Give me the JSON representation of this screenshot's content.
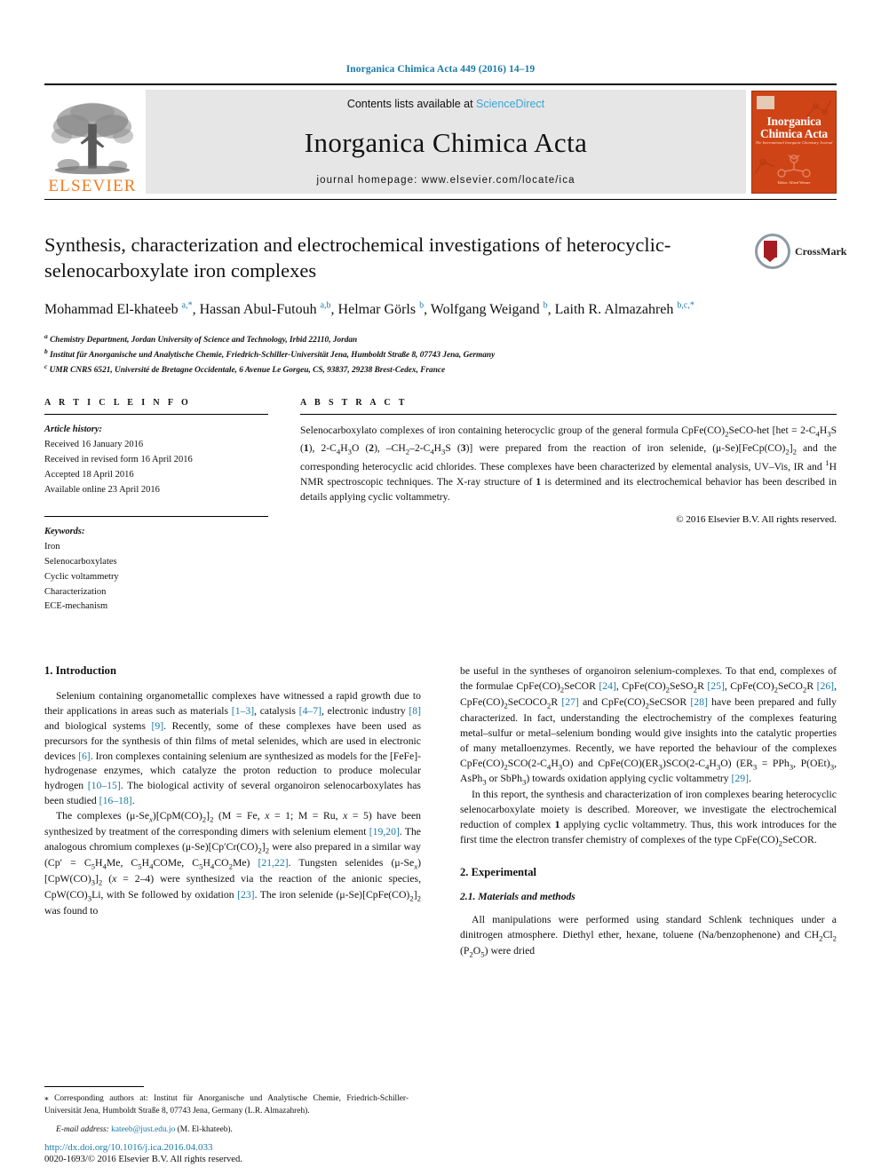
{
  "running_head": "Inorganica Chimica Acta 449 (2016) 14–19",
  "masthead": {
    "publisher_name": "ELSEVIER",
    "contents_prefix": "Contents lists available at ",
    "contents_link": "ScienceDirect",
    "journal_title": "Inorganica Chimica Acta",
    "homepage": "journal homepage: www.elsevier.com/locate/ica",
    "cover": {
      "line1": "Inorganica",
      "line2": "Chimica Acta",
      "subtitle": "The International Inorganic Chemistry Journal",
      "footer": "Editor: Alfred Werner"
    }
  },
  "article": {
    "title": "Synthesis, characterization and electrochemical investigations of heterocyclic-selenocarboxylate iron complexes",
    "crossmark_label": "CrossMark",
    "authors_html": "Mohammad El-khateeb <sup>a,*</sup>, Hassan Abul-Futouh <sup>a,b</sup>, Helmar Görls <sup>b</sup>, Wolfgang Weigand <sup>b</sup>, Laith R. Almazahreh <sup>b,c,*</sup>",
    "affiliations": [
      "<sup>a</sup> Chemistry Department, Jordan University of Science and Technology, Irbid 22110, Jordan",
      "<sup>b</sup> Institut für Anorganische und Analytische Chemie, Friedrich-Schiller-Universität Jena, Humboldt Straße 8, 07743 Jena, Germany",
      "<sup>c</sup> UMR CNRS 6521, Université de Bretagne Occidentale, 6 Avenue Le Gorgeu, CS, 93837, 29238 Brest-Cedex, France"
    ]
  },
  "article_info": {
    "heading": "A R T I C L E   I N F O",
    "history_label": "Article history:",
    "history": [
      "Received 16 January 2016",
      "Received in revised form 16 April 2016",
      "Accepted 18 April 2016",
      "Available online 23 April 2016"
    ],
    "keywords_label": "Keywords:",
    "keywords": [
      "Iron",
      "Selenocarboxylates",
      "Cyclic voltammetry",
      "Characterization",
      "ECE-mechanism"
    ]
  },
  "abstract": {
    "heading": "A B S T R A C T",
    "text_html": "Selenocarboxylato complexes of iron containing heterocyclic group of the general formula CpFe(CO)<sub>2</sub>SeCO-het [het = 2-C<sub>4</sub>H<sub>3</sub>S (<b>1</b>), 2-C<sub>4</sub>H<sub>3</sub>O (<b>2</b>), –CH<sub>2</sub>–2-C<sub>4</sub>H<sub>3</sub>S (<b>3</b>)] were prepared from the reaction of iron selenide, (μ-Se)[FeCp(CO)<sub>2</sub>]<sub>2</sub> and the corresponding heterocyclic acid chlorides. These complexes have been characterized by elemental analysis, UV–Vis, IR and <sup>1</sup>H NMR spectroscopic techniques. The X-ray structure of <b>1</b> is determined and its electrochemical behavior has been described in details applying cyclic voltammetry.",
    "copyright": "© 2016 Elsevier B.V. All rights reserved."
  },
  "body": {
    "introduction_heading": "1. Introduction",
    "intro_p1_html": "Selenium containing organometallic complexes have witnessed a rapid growth due to their applications in areas such as materials <span class=\"ref\">[1–3]</span>, catalysis <span class=\"ref\">[4–7]</span>, electronic industry <span class=\"ref\">[8]</span> and biological systems <span class=\"ref\">[9]</span>. Recently, some of these complexes have been used as precursors for the synthesis of thin films of metal selenides, which are used in electronic devices <span class=\"ref\">[6]</span>. Iron complexes containing selenium are synthesized as models for the [FeFe]-hydrogenase enzymes, which catalyze the proton reduction to produce molecular hydrogen <span class=\"ref\">[10–15]</span>. The biological activity of several organoiron selenocarboxylates has been studied <span class=\"ref\">[16–18]</span>.",
    "intro_p2_html": "The complexes (μ-Se<sub><i>x</i></sub>)[CpM(CO)<sub>2</sub>]<sub>2</sub> (M = Fe, <i>x</i> = 1; M = Ru, <i>x</i> = 5) have been synthesized by treatment of the corresponding dimers with selenium element <span class=\"ref\">[19,20]</span>. The analogous chromium complexes (μ-Se)[Cp′Cr(CO)<sub>2</sub>]<sub>2</sub> were also prepared in a similar way (Cp′ = C<sub>5</sub>H<sub>4</sub>Me, C<sub>5</sub>H<sub>4</sub>COMe, C<sub>5</sub>H<sub>4</sub>CO<sub>2</sub>Me) <span class=\"ref\">[21,22]</span>. Tungsten selenides (μ-Se<sub><i>x</i></sub>)[CpW(CO)<sub>3</sub>]<sub>2</sub> (<i>x</i> = 2–4) were synthesized via the reaction of the anionic species, CpW(CO)<sub>3</sub>Li, with Se followed by oxidation <span class=\"ref\">[23]</span>. The iron selenide (μ-Se)[CpFe(CO)<sub>2</sub>]<sub>2</sub> was found to",
    "right_p1_html": "be useful in the syntheses of organoiron selenium-complexes. To that end, complexes of the formulae CpFe(CO)<sub>2</sub>SeCOR <span class=\"ref\">[24]</span>, CpFe(CO)<sub>2</sub>SeSO<sub>2</sub>R <span class=\"ref\">[25]</span>, CpFe(CO)<sub>2</sub>SeCO<sub>2</sub>R <span class=\"ref\">[26]</span>, CpFe(CO)<sub>2</sub>SeCOCO<sub>2</sub>R <span class=\"ref\">[27]</span> and CpFe(CO)<sub>2</sub>SeCSOR <span class=\"ref\">[28]</span> have been prepared and fully characterized. In fact, understanding the electrochemistry of the complexes featuring metal–sulfur or metal–selenium bonding would give insights into the catalytic properties of many metalloenzymes. Recently, we have reported the behaviour of the complexes CpFe(CO)<sub>2</sub>SCO(2-C<sub>4</sub>H<sub>3</sub>O) and CpFe(CO)(ER<sub>3</sub>)SCO(2-C<sub>4</sub>H<sub>3</sub>O) (ER<sub>3</sub> = PPh<sub>3</sub>, P(OEt)<sub>3</sub>, AsPh<sub>3</sub> or SbPh<sub>3</sub>) towards oxidation applying cyclic voltammetry <span class=\"ref\">[29]</span>.",
    "right_p2_html": "In this report, the synthesis and characterization of iron complexes bearing heterocyclic selenocarboxylate moiety is described. Moreover, we investigate the electrochemical reduction of complex <b>1</b> applying cyclic voltammetry. Thus, this work introduces for the first time the electron transfer chemistry of complexes of the type CpFe(CO)<sub>2</sub>SeCOR.",
    "experimental_heading": "2. Experimental",
    "materials_heading": "2.1. Materials and methods",
    "materials_p1_html": "All manipulations were performed using standard Schlenk techniques under a dinitrogen atmosphere. Diethyl ether, hexane, toluene (Na/benzophenone) and CH<sub>2</sub>Cl<sub>2</sub> (P<sub>2</sub>O<sub>5</sub>) were dried"
  },
  "footer": {
    "corresponding_html": "⁎ Corresponding authors at: Institut für Anorganische und Analytische Chemie, Friedrich-Schiller-Universität Jena, Humboldt Straße 8, 07743 Jena, Germany (L.R. Almazahreh).",
    "email_label": "E-mail address:",
    "email": "kateeb@just.edu.jo",
    "email_owner": "(M. El-khateeb).",
    "doi": "http://dx.doi.org/10.1016/j.ica.2016.04.033",
    "issn_line": "0020-1693/© 2016 Elsevier B.V. All rights reserved."
  },
  "colors": {
    "link_blue": "#1a7aa8",
    "sciencedirect_blue": "#3aa3d4",
    "elsevier_orange": "#f07d22",
    "cover_orange": "#cf4416"
  }
}
